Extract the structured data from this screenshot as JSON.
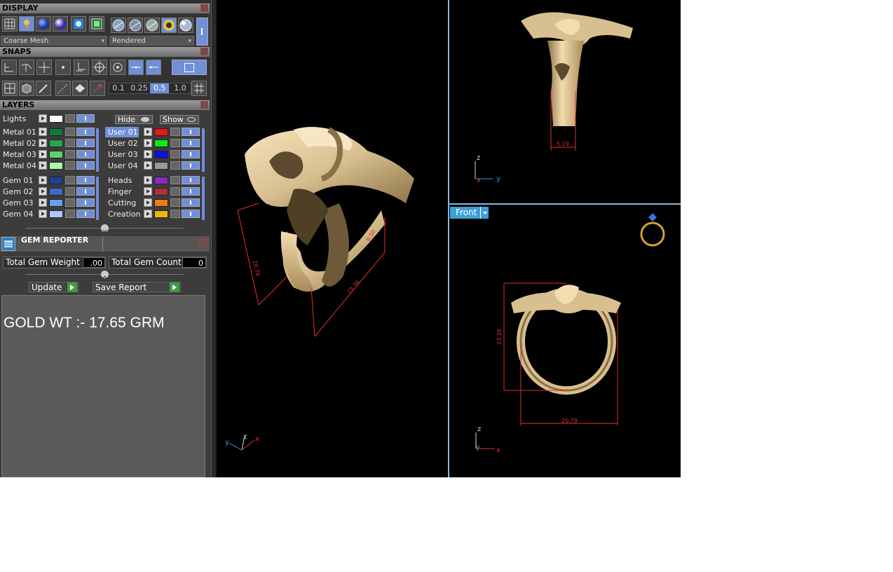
{
  "display": {
    "title": "DISPLAY",
    "mesh_dropdown": "Coarse Mesh",
    "render_dropdown": "Rendered"
  },
  "snaps": {
    "title": "SNAPS",
    "increments": [
      "0.1",
      "0.25",
      "0.5",
      "1.0"
    ],
    "active_increment": "0.5"
  },
  "layers": {
    "title": "LAYERS",
    "lights_label": "Lights",
    "hide_label": "Hide",
    "show_label": "Show",
    "left_group1": [
      {
        "name": "Metal 01",
        "color": "#0e7a3a"
      },
      {
        "name": "Metal 02",
        "color": "#27a54f"
      },
      {
        "name": "Metal 03",
        "color": "#58d46a"
      },
      {
        "name": "Metal 04",
        "color": "#aef5a6"
      }
    ],
    "left_group2": [
      {
        "name": "Gem 01",
        "color": "#1f3f9e"
      },
      {
        "name": "Gem 02",
        "color": "#3a6acb"
      },
      {
        "name": "Gem 03",
        "color": "#6a9ef0"
      },
      {
        "name": "Gem 04",
        "color": "#a9c8f7"
      }
    ],
    "right_group1": [
      {
        "name": "User 01",
        "color": "#e81818"
      },
      {
        "name": "User 02",
        "color": "#14e814"
      },
      {
        "name": "User 03",
        "color": "#1010e0"
      },
      {
        "name": "User 04",
        "color": "#9a9a9a"
      }
    ],
    "right_group2": [
      {
        "name": "Heads",
        "color": "#8a2bc2"
      },
      {
        "name": "Finger",
        "color": "#b0303a"
      },
      {
        "name": "Cutting",
        "color": "#f07a14"
      },
      {
        "name": "Creation",
        "color": "#f2b414"
      }
    ]
  },
  "gem_reporter": {
    "title": "GEM REPORTER",
    "total_weight_label": "Total Gem Weight",
    "total_weight_value": ".00",
    "total_count_label": "Total Gem Count",
    "total_count_value": "0",
    "update_label": "Update",
    "save_report_label": "Save Report",
    "note": "GOLD WT :- 17.65 GRM"
  },
  "viewports": {
    "perspective": {
      "dim1": "20.76",
      "dim2": "8.50",
      "dim3": "23.36",
      "axes": [
        "y",
        "z",
        "x"
      ]
    },
    "right": {
      "dim": "5.19",
      "axes": [
        "z",
        "x",
        "y"
      ]
    },
    "front": {
      "label": "Front",
      "dim_height": "23.26",
      "dim_width": "20.79",
      "axes": [
        "z",
        "y",
        "x"
      ]
    }
  },
  "colors": {
    "gold": "#d7bf8f",
    "dimension": "#e03030",
    "accent": "#6f8fd6",
    "front_tab": "#3d9fd8"
  }
}
